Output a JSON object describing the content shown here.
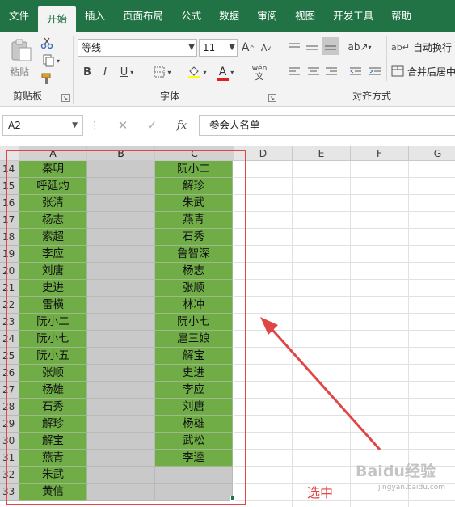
{
  "menu": {
    "items": [
      "文件",
      "开始",
      "插入",
      "页面布局",
      "公式",
      "数据",
      "审阅",
      "视图",
      "开发工具",
      "帮助"
    ],
    "active_index": 1
  },
  "ribbon": {
    "clipboard": {
      "paste_label": "粘贴",
      "group_label": "剪贴板"
    },
    "font": {
      "font_name": "等线",
      "font_size": "11",
      "grow_label": "A",
      "shrink_label": "A",
      "bold": "B",
      "italic": "I",
      "underline": "U",
      "font_color_letter": "A",
      "phonetic_top": "wén",
      "phonetic_bottom": "文",
      "group_label": "字体"
    },
    "alignment": {
      "wrap_label": "自动换行",
      "merge_label": "合并后居中",
      "group_label": "对齐方式"
    }
  },
  "formula_bar": {
    "name_box": "A2",
    "fx_label": "fx",
    "content": "参会人名单"
  },
  "columns": [
    "A",
    "B",
    "C",
    "D",
    "E",
    "F",
    "G"
  ],
  "selected_columns": [
    "A",
    "B",
    "C"
  ],
  "rows": [
    {
      "n": "14",
      "a": "秦明",
      "c": "阮小二"
    },
    {
      "n": "15",
      "a": "呼延灼",
      "c": "解珍"
    },
    {
      "n": "16",
      "a": "张清",
      "c": "朱武"
    },
    {
      "n": "17",
      "a": "杨志",
      "c": "燕青"
    },
    {
      "n": "18",
      "a": "索超",
      "c": "石秀"
    },
    {
      "n": "19",
      "a": "李应",
      "c": "鲁智深"
    },
    {
      "n": "20",
      "a": "刘唐",
      "c": "杨志"
    },
    {
      "n": "21",
      "a": "史进",
      "c": "张顺"
    },
    {
      "n": "22",
      "a": "雷横",
      "c": "林冲"
    },
    {
      "n": "23",
      "a": "阮小二",
      "c": "阮小七"
    },
    {
      "n": "24",
      "a": "阮小七",
      "c": "扈三娘"
    },
    {
      "n": "25",
      "a": "阮小五",
      "c": "解宝"
    },
    {
      "n": "26",
      "a": "张顺",
      "c": "史进"
    },
    {
      "n": "27",
      "a": "杨雄",
      "c": "李应"
    },
    {
      "n": "28",
      "a": "石秀",
      "c": "刘唐"
    },
    {
      "n": "29",
      "a": "解珍",
      "c": "杨雄"
    },
    {
      "n": "30",
      "a": "解宝",
      "c": "武松"
    },
    {
      "n": "31",
      "a": "燕青",
      "c": "李逵"
    },
    {
      "n": "32",
      "a": "朱武",
      "c": ""
    },
    {
      "n": "33",
      "a": "黄信",
      "c": ""
    }
  ],
  "annotation": {
    "text": "选中",
    "color": "#e04646"
  },
  "watermark": {
    "text": "Baidu经验",
    "sub": "jingyan.baidu.com"
  },
  "colors": {
    "accent": "#217346",
    "cell_green": "#70ad47",
    "cell_gray": "#c9c9c9"
  }
}
